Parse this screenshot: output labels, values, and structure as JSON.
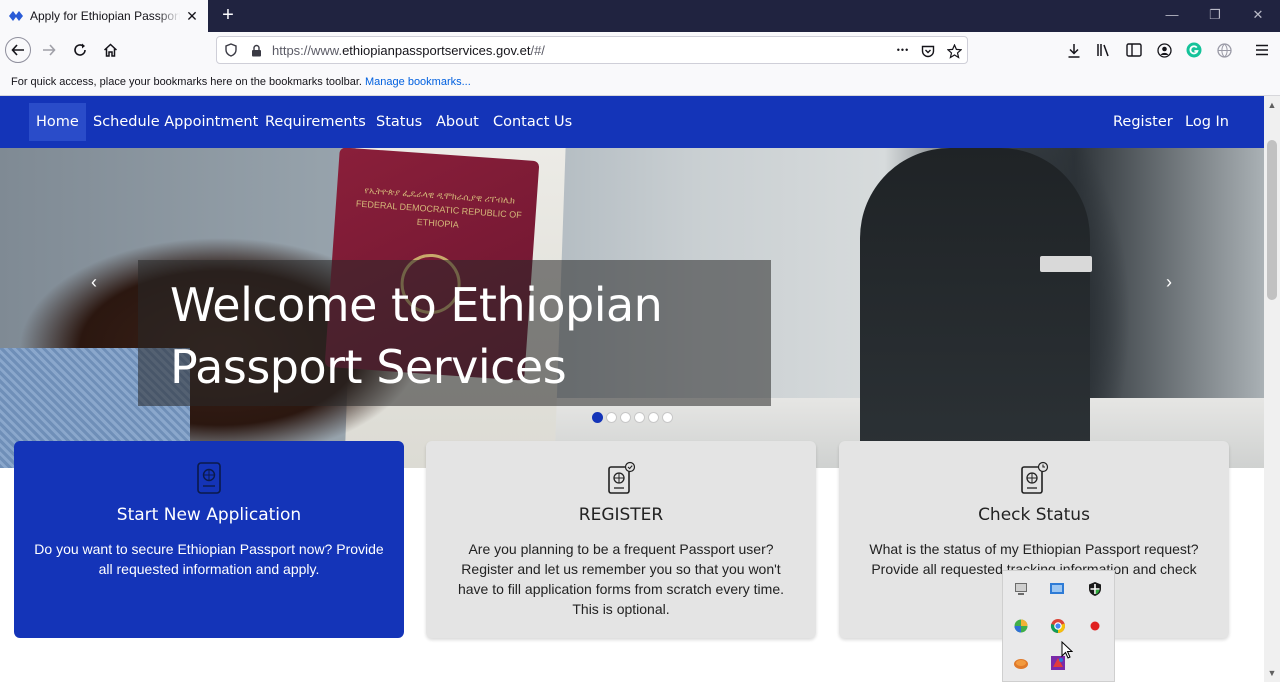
{
  "browser": {
    "tab_title": "Apply for Ethiopian Passport Online",
    "new_tab_symbol": "+",
    "url_prefix": "https://www.",
    "url_domain": "ethiopianpassportservices.gov.et",
    "url_path": "/#/",
    "more_symbol": "•••",
    "bookmarks_text": "For quick access, place your bookmarks here on the bookmarks toolbar.",
    "bookmarks_link": "Manage bookmarks..."
  },
  "site": {
    "nav": [
      "Home",
      "Schedule Appointment",
      "Requirements",
      "Status",
      "About",
      "Contact Us"
    ],
    "auth": [
      "Register",
      "Log In"
    ],
    "hero": {
      "title": "Welcome to Ethiopian Passport Services",
      "passport_text": "የኢትዮጵያ ፌዴራላዊ ዲሞክራሲያዊ ሪፐብሊክ FEDERAL DEMOCRATIC REPUBLIC OF ETHIOPIA",
      "slides": 6,
      "active_slide": 0
    },
    "cards": [
      {
        "title": "Start New Application",
        "desc": "Do you want to secure Ethiopian Passport now? Provide all requested information and apply."
      },
      {
        "title": "REGISTER",
        "desc": "Are you planning to be a frequent Passport user? Register and let us remember you so that you won't have to fill application forms from scratch every time. This is optional."
      },
      {
        "title": "Check Status",
        "desc": "What is the status of my Ethiopian Passport request? Provide all requested tracking information and check"
      }
    ]
  },
  "colors": {
    "brand_blue": "#1434b8",
    "card_grey": "#e4e4e4",
    "tab_bar": "#202340"
  }
}
